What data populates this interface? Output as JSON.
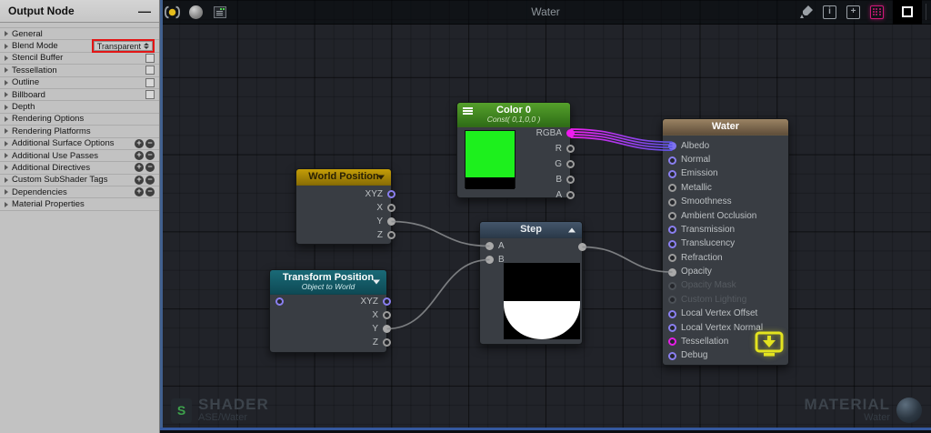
{
  "inspector": {
    "title": "Output Node",
    "minimize_label": "—",
    "rows": [
      {
        "label": "General",
        "control": "none"
      },
      {
        "label": "Blend Mode",
        "control": "dropdown",
        "value": "Transparent",
        "highlighted": true
      },
      {
        "label": "Stencil Buffer",
        "control": "checkbox",
        "checked": false
      },
      {
        "label": "Tessellation",
        "control": "checkbox",
        "checked": false
      },
      {
        "label": "Outline",
        "control": "checkbox",
        "checked": false
      },
      {
        "label": "Billboard",
        "control": "checkbox",
        "checked": false
      },
      {
        "label": "Depth",
        "control": "none"
      },
      {
        "label": "Rendering Options",
        "control": "none"
      },
      {
        "label": "Rendering Platforms",
        "control": "none"
      },
      {
        "label": "Additional Surface Options",
        "control": "plusminus"
      },
      {
        "label": "Additional Use Passes",
        "control": "plusminus"
      },
      {
        "label": "Additional Directives",
        "control": "plusminus"
      },
      {
        "label": "Custom SubShader Tags",
        "control": "plusminus"
      },
      {
        "label": "Dependencies",
        "control": "plusminus"
      },
      {
        "label": "Material Properties",
        "control": "none"
      }
    ],
    "plus_label": "+",
    "minus_label": "−"
  },
  "toolbar": {
    "title": "Water",
    "left_icons": [
      "focus-selection-icon",
      "sphere-preview-icon",
      "console-panel-icon"
    ],
    "right_icons": [
      "clean-icon",
      "info-icon",
      "add-node-icon",
      "grid-snap-icon",
      "maximize-icon"
    ]
  },
  "nodes": {
    "color0": {
      "title": "Color 0",
      "subtitle": "Const( 0,1,0,0 )",
      "header_from": "#55a02b",
      "header_to": "#2f6d17",
      "title_color": "#ffffff",
      "sub_color": "#d4e6c2",
      "swatch_color": "#1df01d",
      "outputs": [
        {
          "label": "RGBA",
          "type": "magenta",
          "connected": true
        },
        {
          "label": "R",
          "type": "float"
        },
        {
          "label": "G",
          "type": "float"
        },
        {
          "label": "B",
          "type": "float"
        },
        {
          "label": "A",
          "type": "float"
        }
      ]
    },
    "world_position": {
      "title": "World Position",
      "header_from": "#c49d07",
      "header_to": "#8a6e06",
      "title_color": "#2a2104",
      "caret": "down",
      "outputs": [
        {
          "label": "XYZ",
          "type": "vector"
        },
        {
          "label": "X",
          "type": "float"
        },
        {
          "label": "Y",
          "type": "float",
          "connected": true
        },
        {
          "label": "Z",
          "type": "float"
        }
      ]
    },
    "transform_position": {
      "title": "Transform Position",
      "subtitle": "Object to World",
      "header_from": "#1a6a77",
      "header_to": "#0e4a55",
      "title_color": "#ffffff",
      "sub_color": "#cfe9ec",
      "caret": "down",
      "inputs": [
        {
          "label": "",
          "type": "vector"
        }
      ],
      "outputs": [
        {
          "label": "XYZ",
          "type": "vector"
        },
        {
          "label": "X",
          "type": "float"
        },
        {
          "label": "Y",
          "type": "float",
          "connected": true
        },
        {
          "label": "Z",
          "type": "float"
        }
      ]
    },
    "step": {
      "title": "Step",
      "header_from": "#44566b",
      "header_to": "#2b3a4a",
      "title_color": "#e9edf0",
      "caret": "up",
      "inputs": [
        {
          "label": "A",
          "type": "float",
          "connected": true
        },
        {
          "label": "B",
          "type": "float",
          "connected": true
        }
      ],
      "outputs": [
        {
          "label": "",
          "type": "float",
          "connected": true
        }
      ]
    },
    "water": {
      "title": "Water",
      "header_from": "#9a8363",
      "header_to": "#604e3a",
      "title_color": "#ffffff",
      "inputs": [
        {
          "label": "Albedo",
          "type": "vector",
          "connected": true
        },
        {
          "label": "Normal",
          "type": "vector"
        },
        {
          "label": "Emission",
          "type": "vector"
        },
        {
          "label": "Metallic",
          "type": "float"
        },
        {
          "label": "Smoothness",
          "type": "float"
        },
        {
          "label": "Ambient Occlusion",
          "type": "float"
        },
        {
          "label": "Transmission",
          "type": "vector"
        },
        {
          "label": "Translucency",
          "type": "vector"
        },
        {
          "label": "Refraction",
          "type": "float"
        },
        {
          "label": "Opacity",
          "type": "float",
          "connected": true
        },
        {
          "label": "Opacity Mask",
          "type": "float",
          "disabled": true
        },
        {
          "label": "Custom Lighting",
          "type": "float",
          "disabled": true
        },
        {
          "label": "Local Vertex Offset",
          "type": "vector"
        },
        {
          "label": "Local Vertex Normal",
          "type": "vector"
        },
        {
          "label": "Tessellation",
          "type": "magenta"
        },
        {
          "label": "Debug",
          "type": "vector"
        }
      ]
    }
  },
  "wires": [
    {
      "from": "color0:RGBA",
      "to": "water:Albedo",
      "style": "cable"
    },
    {
      "from": "world_position:Y",
      "to": "step:A",
      "style": "wire"
    },
    {
      "from": "transform_position:Y",
      "to": "step:B",
      "style": "wire"
    },
    {
      "from": "step:out",
      "to": "water:Opacity",
      "style": "wire"
    }
  ],
  "watermarks": {
    "shader": {
      "badge": "S",
      "title": "SHADER",
      "subtitle": "ASE/Water"
    },
    "material": {
      "title": "MATERIAL",
      "subtitle": "Water"
    }
  },
  "colors": {
    "highlight_red": "#e31616",
    "port_vector": "#8a7ff0",
    "port_float": "#9c9c9c",
    "port_magenta": "#ef19ef",
    "cable_from": "#ef1fef",
    "cable_to": "#5b54e8",
    "wire_gray": "#8b8d8f",
    "save_icon_yellow": "#e3e31f"
  }
}
